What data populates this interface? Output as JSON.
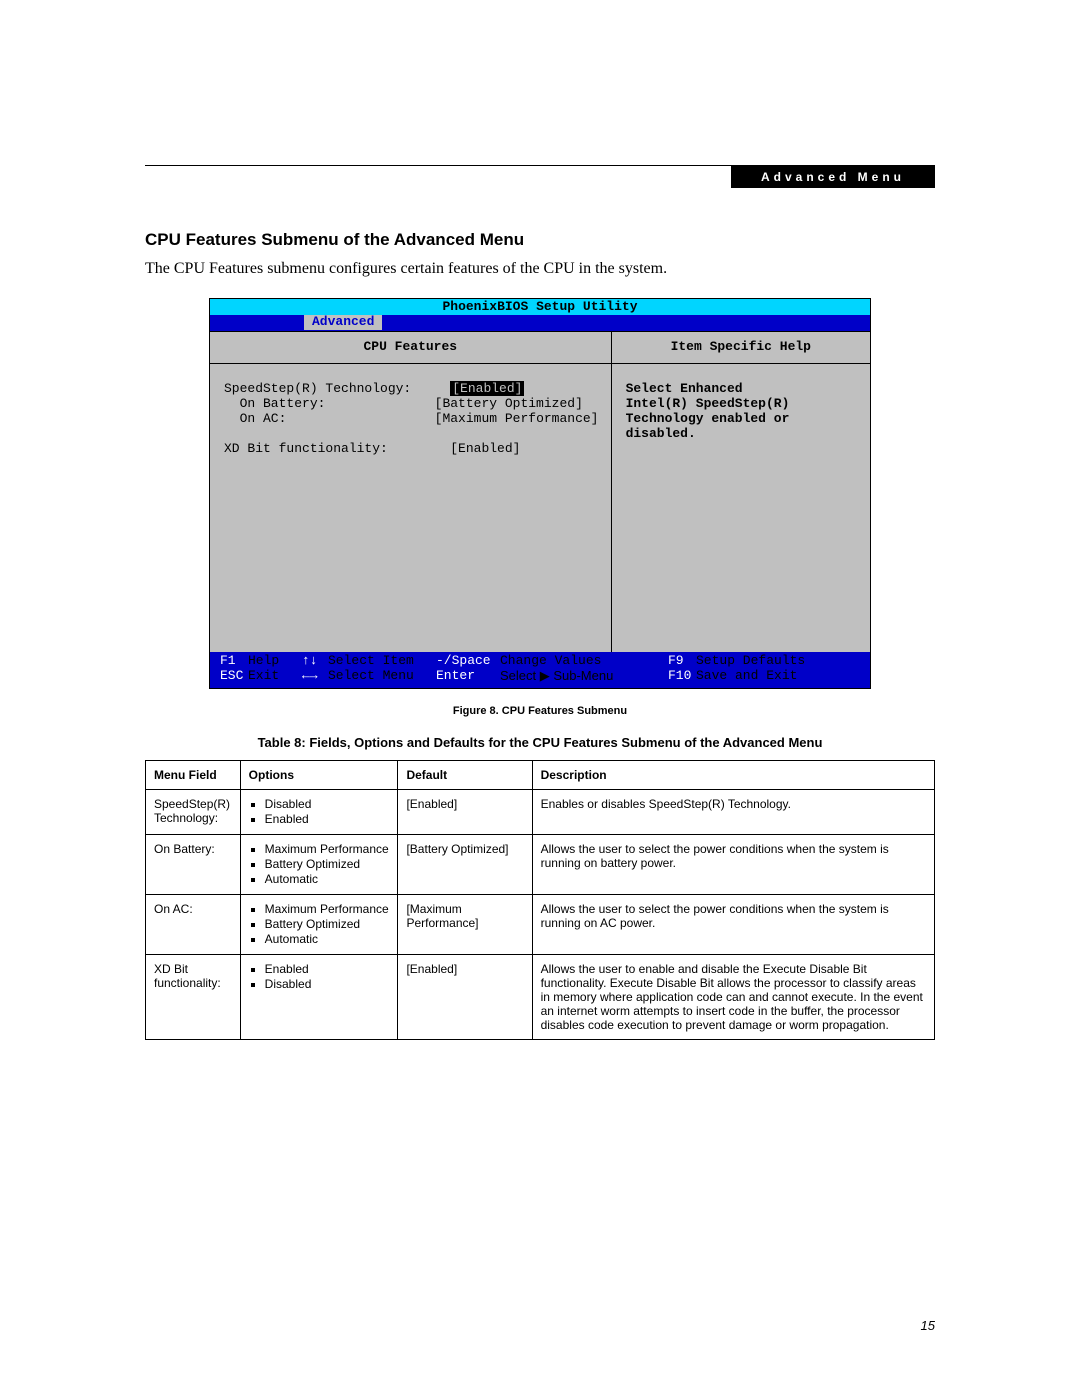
{
  "header": {
    "chip": "Advanced Menu"
  },
  "section": {
    "title": "CPU Features Submenu of the Advanced Menu",
    "intro": "The CPU Features submenu configures certain features of the CPU in the system."
  },
  "bios": {
    "title": "PhoenixBIOS Setup Utility",
    "tab": "Advanced",
    "left_title": "CPU Features",
    "right_title": "Item Specific Help",
    "rows": {
      "r1_label": "SpeedStep(R) Technology:",
      "r1_val": "[Enabled]",
      "r2_label": "  On Battery:",
      "r2_val": "[Battery Optimized]",
      "r3_label": "  On AC:",
      "r3_val": "[Maximum Performance]",
      "r4_label": "XD Bit functionality:",
      "r4_val": "[Enabled]"
    },
    "help_text": "Select Enhanced\nIntel(R) SpeedStep(R)\nTechnology enabled or\ndisabled.",
    "footer": {
      "f1": "F1",
      "help": "Help",
      "arr_ud": "↑↓",
      "sel_item": "Select Item",
      "minus_space": "-/Space",
      "change_vals": "Change Values",
      "f9": "F9",
      "setup_def": "Setup Defaults",
      "esc": "ESC",
      "exit": "Exit",
      "arr_lr": "←→",
      "sel_menu": "Select Menu",
      "enter": "Enter",
      "sel_sub": "Select ▶ Sub-Menu",
      "f10": "F10",
      "save_exit": "Save and Exit"
    }
  },
  "figure": {
    "caption": "Figure 8.   CPU Features Submenu"
  },
  "table": {
    "caption": "Table 8: Fields, Options and Defaults for the CPU Features Submenu of the Advanced Menu",
    "headers": {
      "field": "Menu Field",
      "options": "Options",
      "default": "Default",
      "desc": "Description"
    },
    "rows": [
      {
        "field": "SpeedStep(R) Technology:",
        "options": [
          "Disabled",
          "Enabled"
        ],
        "default": "[Enabled]",
        "desc": "Enables or disables SpeedStep(R) Technology."
      },
      {
        "field": "On Battery:",
        "options": [
          "Maximum Performance",
          "Battery Optimized",
          "Automatic"
        ],
        "default": "[Battery Optimized]",
        "desc": "Allows the user to select the power conditions when the system is running on battery power."
      },
      {
        "field": "On AC:",
        "options": [
          "Maximum Performance",
          "Battery Optimized",
          "Automatic"
        ],
        "default": "[Maximum Performance]",
        "desc": "Allows the user to select the power conditions when the system is running on AC power."
      },
      {
        "field": "XD Bit functionality:",
        "options": [
          "Enabled",
          "Disabled"
        ],
        "default": "[Enabled]",
        "desc": "Allows the user to enable and disable the Execute Disable Bit functionality. Execute Disable Bit allows the processor to classify areas in memory where application code can and cannot execute. In the event an internet worm attempts to insert code in the buffer, the processor disables code execution to prevent damage or worm propagation."
      }
    ]
  },
  "page_number": "15"
}
